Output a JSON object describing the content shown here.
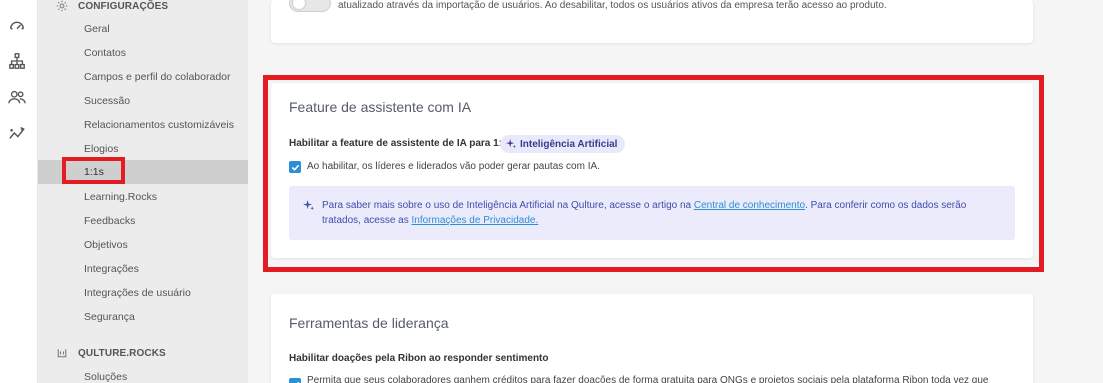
{
  "rail": {
    "icons": [
      "dashboard-icon",
      "org-chart-icon",
      "people-icon",
      "analytics-icon"
    ]
  },
  "sidebar": {
    "config_header": "CONFIGURAÇÕES",
    "items": [
      {
        "label": "Geral"
      },
      {
        "label": "Contatos"
      },
      {
        "label": "Campos e perfil do colaborador"
      },
      {
        "label": "Sucessão"
      },
      {
        "label": "Relacionamentos customizáveis"
      },
      {
        "label": "Elogios"
      },
      {
        "label": "1:1s",
        "active": true
      },
      {
        "label": "Learning.Rocks"
      },
      {
        "label": "Feedbacks"
      },
      {
        "label": "Objetivos"
      },
      {
        "label": "Integrações"
      },
      {
        "label": "Integrações de usuário"
      },
      {
        "label": "Segurança"
      }
    ],
    "rocks_header": "QULTURE.ROCKS",
    "rocks_items": [
      {
        "label": "Soluções"
      }
    ]
  },
  "top_card": {
    "text": "atualizado através da importação de usuários. Ao desabilitar, todos os usuários ativos da empresa terão acesso ao produto."
  },
  "ai_card": {
    "title": "Feature de assistente com IA",
    "enable_label": "Habilitar a feature de assistente de IA para 1:1",
    "badge": "Inteligência Artificial",
    "checkbox_text": "Ao habilitar, os líderes e liderados vão poder gerar pautas com IA.",
    "info_part1": "Para saber mais sobre o uso de Inteligência Artificial na Qulture, acesse o artigo na ",
    "info_link1": "Central de conhecimento",
    "info_part2": ". Para conferir como os dados serão tratados, acesse as ",
    "info_link2": "Informações de Privacidade."
  },
  "leadership_card": {
    "title": "Ferramentas de liderança",
    "enable_label": "Habilitar doações pela Ribon ao responder sentimento",
    "checkbox_text": "Permita que seus colaboradores ganhem créditos para fazer doações de forma gratuita para ONGs e projetos sociais pela plataforma Ribon toda vez que"
  },
  "colors": {
    "highlight": "#e31b23",
    "checkbox": "#2b8fd6",
    "info_bg": "#ebebfb",
    "info_text": "#3f4dae"
  }
}
